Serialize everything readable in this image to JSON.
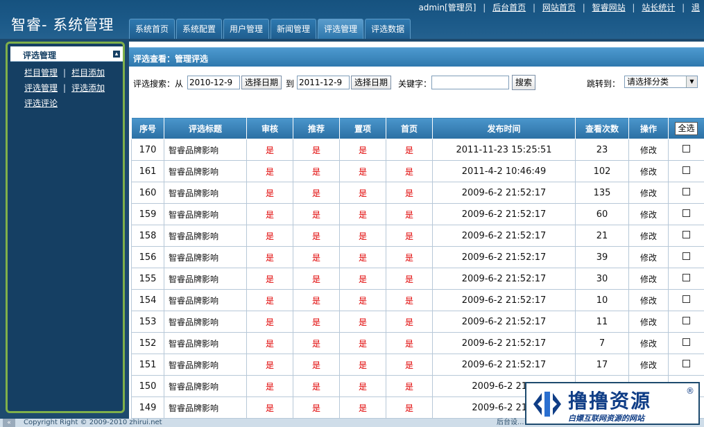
{
  "app": {
    "title": "智睿- 系统管理"
  },
  "toplinks": {
    "user": "admin[管理员]",
    "links": [
      "后台首页",
      "网站首页",
      "智睿网站",
      "站长统计"
    ],
    "edge_text": "退出"
  },
  "tabs": [
    {
      "label": "系统首页",
      "active": false
    },
    {
      "label": "系统配置",
      "active": false
    },
    {
      "label": "用户管理",
      "active": false
    },
    {
      "label": "新闻管理",
      "active": false
    },
    {
      "label": "评选管理",
      "active": true
    },
    {
      "label": "评选数据",
      "active": false
    }
  ],
  "sidebar": {
    "title": "评选管理",
    "rows": [
      {
        "a": "栏目管理",
        "b": "栏目添加"
      },
      {
        "a": "评选管理",
        "b": "评选添加"
      },
      {
        "a": "评选评论",
        "b": ""
      }
    ]
  },
  "panel": {
    "title": "评选查看：管理评选"
  },
  "search": {
    "label_from": "评选搜索：从",
    "date_from": "2010-12-9",
    "pick_date": "选择日期",
    "label_to": "到",
    "date_to": "2011-12-9",
    "label_keyword": "关键字：",
    "keyword_value": "",
    "search_button": "搜索",
    "jump_label": "跳转到：",
    "category_selected": "请选择分类"
  },
  "table": {
    "headers": [
      "序号",
      "评选标题",
      "审核",
      "推荐",
      "置项",
      "首页",
      "发布时间",
      "查看次数",
      "操作"
    ],
    "select_all": "全选",
    "rows": [
      {
        "id": "170",
        "title": "智睿品牌影响",
        "audit": "是",
        "recommend": "是",
        "top": "是",
        "home": "是",
        "time": "2011-11-23 15:25:51",
        "views": "23",
        "action": "修改"
      },
      {
        "id": "161",
        "title": "智睿品牌影响",
        "audit": "是",
        "recommend": "是",
        "top": "是",
        "home": "是",
        "time": "2011-4-2 10:46:49",
        "views": "102",
        "action": "修改"
      },
      {
        "id": "160",
        "title": "智睿品牌影响",
        "audit": "是",
        "recommend": "是",
        "top": "是",
        "home": "是",
        "time": "2009-6-2 21:52:17",
        "views": "135",
        "action": "修改"
      },
      {
        "id": "159",
        "title": "智睿品牌影响",
        "audit": "是",
        "recommend": "是",
        "top": "是",
        "home": "是",
        "time": "2009-6-2 21:52:17",
        "views": "60",
        "action": "修改"
      },
      {
        "id": "158",
        "title": "智睿品牌影响",
        "audit": "是",
        "recommend": "是",
        "top": "是",
        "home": "是",
        "time": "2009-6-2 21:52:17",
        "views": "21",
        "action": "修改"
      },
      {
        "id": "156",
        "title": "智睿品牌影响",
        "audit": "是",
        "recommend": "是",
        "top": "是",
        "home": "是",
        "time": "2009-6-2 21:52:17",
        "views": "39",
        "action": "修改"
      },
      {
        "id": "155",
        "title": "智睿品牌影响",
        "audit": "是",
        "recommend": "是",
        "top": "是",
        "home": "是",
        "time": "2009-6-2 21:52:17",
        "views": "30",
        "action": "修改"
      },
      {
        "id": "154",
        "title": "智睿品牌影响",
        "audit": "是",
        "recommend": "是",
        "top": "是",
        "home": "是",
        "time": "2009-6-2 21:52:17",
        "views": "10",
        "action": "修改"
      },
      {
        "id": "153",
        "title": "智睿品牌影响",
        "audit": "是",
        "recommend": "是",
        "top": "是",
        "home": "是",
        "time": "2009-6-2 21:52:17",
        "views": "11",
        "action": "修改"
      },
      {
        "id": "152",
        "title": "智睿品牌影响",
        "audit": "是",
        "recommend": "是",
        "top": "是",
        "home": "是",
        "time": "2009-6-2 21:52:17",
        "views": "7",
        "action": "修改"
      },
      {
        "id": "151",
        "title": "智睿品牌影响",
        "audit": "是",
        "recommend": "是",
        "top": "是",
        "home": "是",
        "time": "2009-6-2 21:52:17",
        "views": "17",
        "action": "修改"
      },
      {
        "id": "150",
        "title": "智睿品牌影响",
        "audit": "是",
        "recommend": "是",
        "top": "是",
        "home": "是",
        "time": "2009-6-2 21:5",
        "views": "",
        "action": ""
      },
      {
        "id": "149",
        "title": "智睿品牌影响",
        "audit": "是",
        "recommend": "是",
        "top": "是",
        "home": "是",
        "time": "2009-6-2 21:5",
        "views": "",
        "action": ""
      }
    ]
  },
  "footer": {
    "toggle": "«",
    "copyright": "Copyright Right © 2009-2010 zhirui.net",
    "right": "后台设..."
  },
  "watermark": {
    "title": "撸撸资源",
    "reg": "®",
    "subtitle": "白嫖互联网资源的网站"
  },
  "colors": {
    "header_bg": "#1c5a89",
    "accent": "#2f78ad",
    "flag_red": "#e00000",
    "sidebar_border": "#7fb04a"
  }
}
